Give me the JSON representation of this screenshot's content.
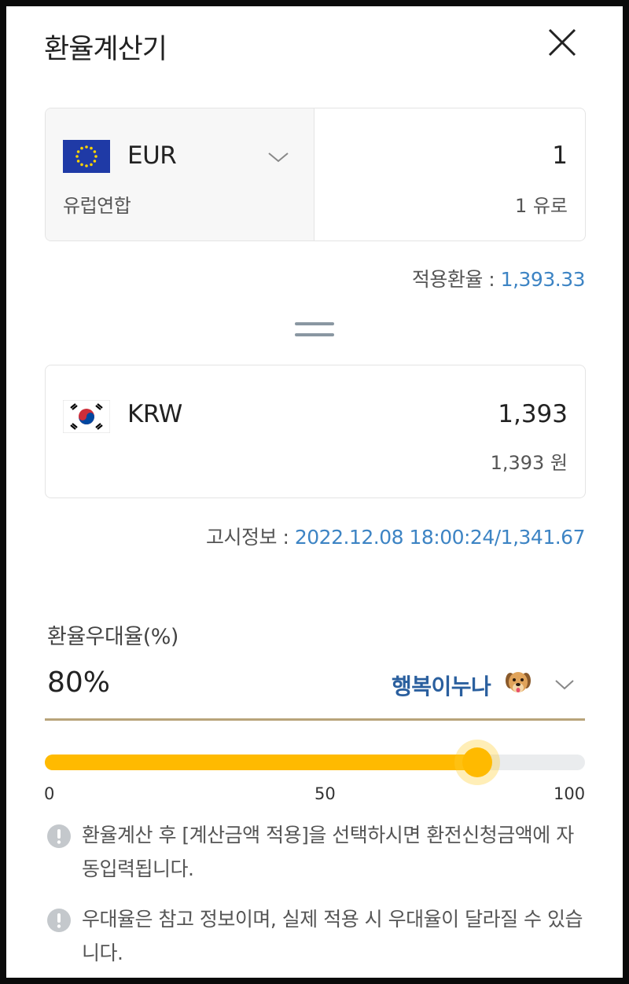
{
  "header": {
    "title": "환율계산기"
  },
  "from": {
    "code": "EUR",
    "name": "유럽연합",
    "amount": "1",
    "amount_text": "1 유로"
  },
  "applied_rate": {
    "label": "적용환율 : ",
    "value": "1,393.33"
  },
  "to": {
    "code": "KRW",
    "amount": "1,393",
    "amount_text": "1,393 원"
  },
  "notice": {
    "label": "고시정보 : ",
    "value": "2022.12.08 18:00:24/1,341.67"
  },
  "preference": {
    "label": "환율우대율(%)",
    "value": "80%",
    "option": "행복이누나"
  },
  "slider": {
    "value": 80,
    "min": 0,
    "max": 100,
    "ticks": [
      "0",
      "50",
      "100"
    ]
  },
  "notes": [
    "환율계산 후 [계산금액 적용]을 선택하시면 환전신청금액에 자동입력됩니다.",
    "우대율은 참고 정보이며, 실제 적용 시 우대율이 달라질 수 있습니다."
  ],
  "colors": {
    "accent_blue": "#3d84c4",
    "slider_fill": "#ffba00",
    "option_text": "#2a5f9e"
  },
  "icons": {
    "close": "close-icon",
    "eu_flag": "eu-flag-icon",
    "kr_flag": "kr-flag-icon",
    "equals": "equals-icon",
    "chevron": "chevron-down-icon",
    "dog": "dog-emoji-icon",
    "info": "exclamation-info-icon"
  }
}
